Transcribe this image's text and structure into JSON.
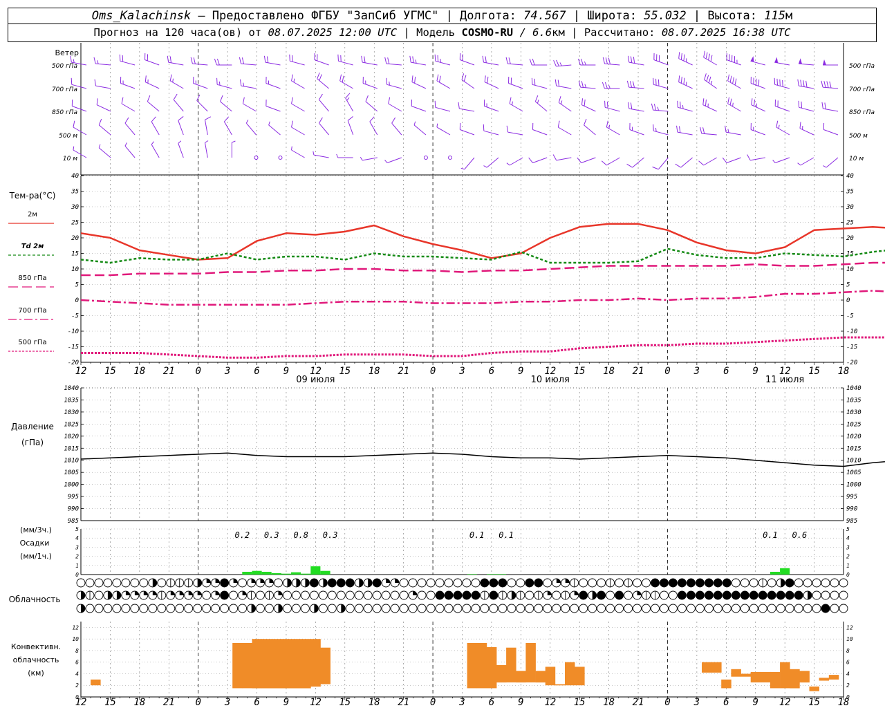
{
  "header": {
    "station": "Oms_Kalachinsk",
    "provider": "— Предоставлено ФГБУ \"ЗапСиб УГМС\"",
    "lon_label": "| Долгота:",
    "lon_value": "74.567",
    "lat_label": "| Широта:",
    "lat_value": "55.032",
    "alt_label": "| Высота:",
    "alt_value": "115",
    "alt_unit": "м",
    "forecast_label": "Прогноз на 120 часа(ов) от",
    "forecast_time": "08.07.2025 12:00 UTC",
    "model_label": "| Модель",
    "model_name": "COSMO-RU",
    "model_res": "/ 6.6",
    "model_res_unit": "км",
    "calc_label": "| Рассчитано:",
    "calc_time": "08.07.2025 16:38 UTC"
  },
  "colors": {
    "wind": "#8b2be2",
    "t2m": "#e8362a",
    "td2m": "#148a14",
    "t850": "#e0187a",
    "t700": "#e0187a",
    "t500": "#e0187a",
    "pressure": "#000000",
    "precip": "#22dd22",
    "convective": "#f08c28"
  },
  "chart_data": {
    "type": "line",
    "x_start": "08.07.2025 12:00 UTC",
    "x_step_hours": 1,
    "x_ticks": [
      "12",
      "15",
      "18",
      "21",
      "0",
      "3",
      "6",
      "9",
      "12",
      "15",
      "18",
      "21",
      "0",
      "3",
      "6",
      "9",
      "12",
      "15",
      "18",
      "21",
      "0",
      "3",
      "6",
      "9",
      "12",
      "15",
      "18"
    ],
    "day_labels": [
      {
        "label": "09 июля",
        "hour": 24
      },
      {
        "label": "10 июля",
        "hour": 48
      },
      {
        "label": "11 июля",
        "hour": 72
      }
    ],
    "wind": {
      "title": "Ветер",
      "levels": [
        "500 гПа",
        "700 гПа",
        "850 гПа",
        "500 м",
        "10 м"
      ],
      "directions_deg": [
        [
          280,
          275,
          285,
          290,
          280,
          275,
          270,
          275,
          280,
          285,
          290,
          285,
          280,
          275,
          280,
          285,
          290,
          280,
          275,
          270,
          265,
          270,
          275,
          280,
          290,
          295,
          300,
          290,
          285,
          280,
          275,
          270
        ],
        [
          285,
          280,
          290,
          295,
          300,
          290,
          285,
          280,
          290,
          300,
          310,
          300,
          290,
          285,
          295,
          300,
          305,
          295,
          290,
          285,
          280,
          275,
          270,
          275,
          285,
          295,
          305,
          300,
          290,
          285,
          280,
          275
        ],
        [
          290,
          295,
          300,
          310,
          320,
          315,
          310,
          300,
          290,
          300,
          320,
          330,
          310,
          300,
          290,
          285,
          280,
          290,
          300,
          310,
          305,
          295,
          285,
          280,
          275,
          285,
          295,
          300,
          295,
          290,
          285,
          280
        ],
        [
          300,
          310,
          320,
          330,
          340,
          350,
          330,
          320,
          310,
          300,
          320,
          340,
          330,
          320,
          310,
          300,
          290,
          285,
          280,
          290,
          300,
          310,
          300,
          290,
          285,
          280,
          275,
          280,
          290,
          300,
          295,
          290
        ],
        [
          300,
          310,
          320,
          330,
          340,
          350,
          0,
          340,
          320,
          300,
          280,
          270,
          260,
          250,
          240,
          230,
          220,
          230,
          240,
          250,
          260,
          250,
          240,
          230,
          220,
          230,
          240,
          250,
          260,
          250,
          240,
          230
        ]
      ],
      "speeds_ms": [
        [
          8,
          8,
          9,
          9,
          10,
          10,
          9,
          9,
          10,
          11,
          11,
          10,
          10,
          11,
          12,
          12,
          11,
          10,
          10,
          11,
          12,
          13,
          14,
          15,
          16,
          18,
          20,
          22,
          24,
          26,
          26,
          25
        ],
        [
          6,
          6,
          7,
          7,
          7,
          8,
          8,
          7,
          7,
          8,
          9,
          9,
          8,
          8,
          9,
          10,
          10,
          9,
          9,
          10,
          11,
          12,
          13,
          14,
          16,
          17,
          18,
          19,
          20,
          21,
          20,
          19
        ],
        [
          5,
          5,
          6,
          6,
          5,
          5,
          6,
          5,
          5,
          6,
          6,
          7,
          6,
          5,
          5,
          6,
          6,
          7,
          7,
          8,
          8,
          9,
          10,
          11,
          12,
          13,
          13,
          12,
          12,
          11,
          11,
          10
        ],
        [
          4,
          4,
          4,
          5,
          5,
          4,
          4,
          3,
          3,
          4,
          4,
          5,
          5,
          4,
          3,
          3,
          4,
          5,
          5,
          6,
          6,
          6,
          7,
          8,
          8,
          9,
          9,
          8,
          8,
          7,
          7,
          6
        ],
        [
          3,
          3,
          3,
          3,
          2,
          2,
          2,
          1,
          1,
          2,
          2,
          2,
          3,
          2,
          1,
          1,
          2,
          3,
          3,
          4,
          4,
          4,
          5,
          5,
          5,
          5,
          4,
          4,
          4,
          3,
          3,
          3
        ]
      ]
    },
    "temperature": {
      "title": "Тем-ра(°C)",
      "ylim": [
        -20,
        40
      ],
      "yticks": [
        -20,
        -15,
        -10,
        -5,
        0,
        5,
        10,
        15,
        20,
        25,
        30,
        35,
        40
      ],
      "x_step_hours": 3,
      "series": [
        {
          "name": "2м",
          "key": "t2m",
          "dash": "",
          "values": [
            21.5,
            20,
            16,
            14.5,
            13,
            13.5,
            19,
            21.5,
            21,
            22,
            24,
            20.5,
            18,
            16,
            13.5,
            15,
            20,
            23.5,
            24.5,
            24.5,
            22.5,
            18.5,
            16,
            15,
            17,
            22.5,
            23,
            23.5,
            23,
            20.5,
            17.5
          ]
        },
        {
          "name": "Td 2м",
          "key": "td2m",
          "dash": "4 3",
          "values": [
            13,
            12,
            13.5,
            13,
            13,
            15,
            13,
            14,
            14,
            13,
            15,
            14,
            14,
            13.5,
            13,
            15.5,
            12,
            12,
            12,
            12.5,
            16.5,
            14.5,
            13.5,
            13.5,
            15,
            14.5,
            14,
            15.5,
            16.5,
            14,
            13.5
          ]
        },
        {
          "name": "850 гПа",
          "key": "t850",
          "dash": "14 6",
          "values": [
            8,
            8,
            8.5,
            8.5,
            8.5,
            9,
            9,
            9.5,
            9.5,
            10,
            10,
            9.5,
            9.5,
            9,
            9.5,
            9.5,
            10,
            10.5,
            11,
            11,
            11,
            11,
            11,
            11.5,
            11,
            11,
            11.5,
            12,
            12,
            11.5,
            9.5
          ]
        },
        {
          "name": "700 гПа",
          "key": "t700",
          "dash": "12 4 3 4",
          "values": [
            0,
            -0.5,
            -1,
            -1.5,
            -1.5,
            -1.5,
            -1.5,
            -1.5,
            -1,
            -0.5,
            -0.5,
            -0.5,
            -1,
            -1,
            -1,
            -0.5,
            -0.5,
            0,
            0,
            0.5,
            0,
            0.5,
            0.5,
            1,
            2,
            2,
            2.5,
            3,
            2.5,
            1.5,
            0
          ]
        },
        {
          "name": "500 гПа",
          "key": "t500",
          "dash": "3 2",
          "values": [
            -17,
            -17,
            -17,
            -17.5,
            -18,
            -18.5,
            -18.5,
            -18,
            -18,
            -17.5,
            -17.5,
            -17.5,
            -18,
            -18,
            -17,
            -16.5,
            -16.5,
            -15.5,
            -15,
            -14.5,
            -14.5,
            -14,
            -14,
            -13.5,
            -13,
            -12.5,
            -12,
            -12,
            -12,
            -12.5,
            -13.5
          ]
        }
      ]
    },
    "pressure": {
      "title": "Давление",
      "unit": "(гПа)",
      "ylim": [
        985,
        1040
      ],
      "yticks": [
        985,
        990,
        995,
        1000,
        1005,
        1010,
        1015,
        1020,
        1025,
        1030,
        1035,
        1040
      ],
      "x_step_hours": 3,
      "values": [
        1010.5,
        1011,
        1011.5,
        1012,
        1012.5,
        1013,
        1012,
        1011.5,
        1011.5,
        1011.5,
        1012,
        1012.5,
        1013,
        1012.5,
        1011.5,
        1011,
        1011,
        1010.5,
        1011,
        1011.5,
        1012,
        1011.5,
        1011,
        1010,
        1009,
        1008,
        1007.5,
        1009,
        1010,
        1010.5,
        1010.5
      ]
    },
    "precip": {
      "title": "Осадки",
      "unit_3h": "(мм/3ч.)",
      "unit_1h": "(мм/1ч.)",
      "ylim": [
        0,
        5
      ],
      "yticks": [
        0,
        1,
        2,
        3,
        4,
        5
      ],
      "hourly_bars": [
        {
          "hour": 17,
          "value": 0.3
        },
        {
          "hour": 18,
          "value": 0.4
        },
        {
          "hour": 19,
          "value": 0.3
        },
        {
          "hour": 20,
          "value": 0.15
        },
        {
          "hour": 21,
          "value": 0.1
        },
        {
          "hour": 22,
          "value": 0.25
        },
        {
          "hour": 23,
          "value": 0.1
        },
        {
          "hour": 24,
          "value": 0.9
        },
        {
          "hour": 25,
          "value": 0.4
        },
        {
          "hour": 40,
          "value": 0.05
        },
        {
          "hour": 42,
          "value": 0.05
        },
        {
          "hour": 43,
          "value": 0.05
        },
        {
          "hour": 71,
          "value": 0.3
        },
        {
          "hour": 72,
          "value": 0.7
        }
      ],
      "sums_3h": [
        {
          "hour": 16.5,
          "label": "0.2"
        },
        {
          "hour": 19.5,
          "label": "0.3"
        },
        {
          "hour": 22.5,
          "label": "0.8"
        },
        {
          "hour": 25.5,
          "label": "0.3"
        },
        {
          "hour": 40.5,
          "label": "0.1"
        },
        {
          "hour": 43.5,
          "label": "0.1"
        },
        {
          "hour": 70.5,
          "label": "0.1"
        },
        {
          "hour": 73.5,
          "label": "0.6"
        }
      ]
    },
    "clouds": {
      "title": "Облачность",
      "rows": [
        "00000000301113224202220333434443342200000000044400440221000101004444444440001034000000",
        "31033222212222024021012000000000000002004444414131012012434040211004444444444444430000",
        "30000000000000000003003000300300000000000000000000000000000000000000000000000000000400"
      ]
    },
    "convective": {
      "title": "Конвективн.",
      "title2": "облачность",
      "unit": "(км)",
      "ylim": [
        0,
        13
      ],
      "yticks": [
        0,
        2,
        4,
        6,
        8,
        10,
        12
      ],
      "bars": [
        {
          "hour": 1.5,
          "base": 2.0,
          "top": 3.0
        },
        {
          "hour": 16,
          "base": 1.5,
          "top": 9.3
        },
        {
          "hour": 17,
          "base": 1.5,
          "top": 9.3
        },
        {
          "hour": 18,
          "base": 1.5,
          "top": 10.0
        },
        {
          "hour": 19,
          "base": 1.5,
          "top": 10.0
        },
        {
          "hour": 20,
          "base": 1.5,
          "top": 10.0
        },
        {
          "hour": 21,
          "base": 1.5,
          "top": 10.0
        },
        {
          "hour": 22,
          "base": 1.5,
          "top": 10.0
        },
        {
          "hour": 23,
          "base": 1.5,
          "top": 10.0
        },
        {
          "hour": 24,
          "base": 1.8,
          "top": 10.0
        },
        {
          "hour": 25,
          "base": 2.2,
          "top": 8.5
        },
        {
          "hour": 40,
          "base": 1.5,
          "top": 9.3
        },
        {
          "hour": 41,
          "base": 1.5,
          "top": 9.3
        },
        {
          "hour": 42,
          "base": 1.5,
          "top": 8.6
        },
        {
          "hour": 43,
          "base": 2.5,
          "top": 5.5
        },
        {
          "hour": 44,
          "base": 2.5,
          "top": 8.5
        },
        {
          "hour": 45,
          "base": 2.5,
          "top": 4.5
        },
        {
          "hour": 46,
          "base": 2.5,
          "top": 9.3
        },
        {
          "hour": 47,
          "base": 2.5,
          "top": 4.5
        },
        {
          "hour": 48,
          "base": 2.0,
          "top": 5.2
        },
        {
          "hour": 49,
          "base": 2.0,
          "top": 2.2
        },
        {
          "hour": 50,
          "base": 2.0,
          "top": 6.0
        },
        {
          "hour": 51,
          "base": 2.0,
          "top": 5.2
        },
        {
          "hour": 64,
          "base": 4.2,
          "top": 6.0
        },
        {
          "hour": 65,
          "base": 4.2,
          "top": 6.0
        },
        {
          "hour": 66,
          "base": 1.5,
          "top": 3.0
        },
        {
          "hour": 67,
          "base": 3.5,
          "top": 4.8
        },
        {
          "hour": 68,
          "base": 3.5,
          "top": 4.0
        },
        {
          "hour": 69,
          "base": 2.5,
          "top": 4.3
        },
        {
          "hour": 70,
          "base": 2.5,
          "top": 4.3
        },
        {
          "hour": 71,
          "base": 1.5,
          "top": 4.3
        },
        {
          "hour": 72,
          "base": 1.5,
          "top": 6.0
        },
        {
          "hour": 73,
          "base": 1.5,
          "top": 4.8
        },
        {
          "hour": 74,
          "base": 2.5,
          "top": 4.5
        },
        {
          "hour": 75,
          "base": 1.0,
          "top": 1.8
        },
        {
          "hour": 76,
          "base": 2.8,
          "top": 3.3
        },
        {
          "hour": 77,
          "base": 3.0,
          "top": 3.8
        }
      ]
    }
  }
}
